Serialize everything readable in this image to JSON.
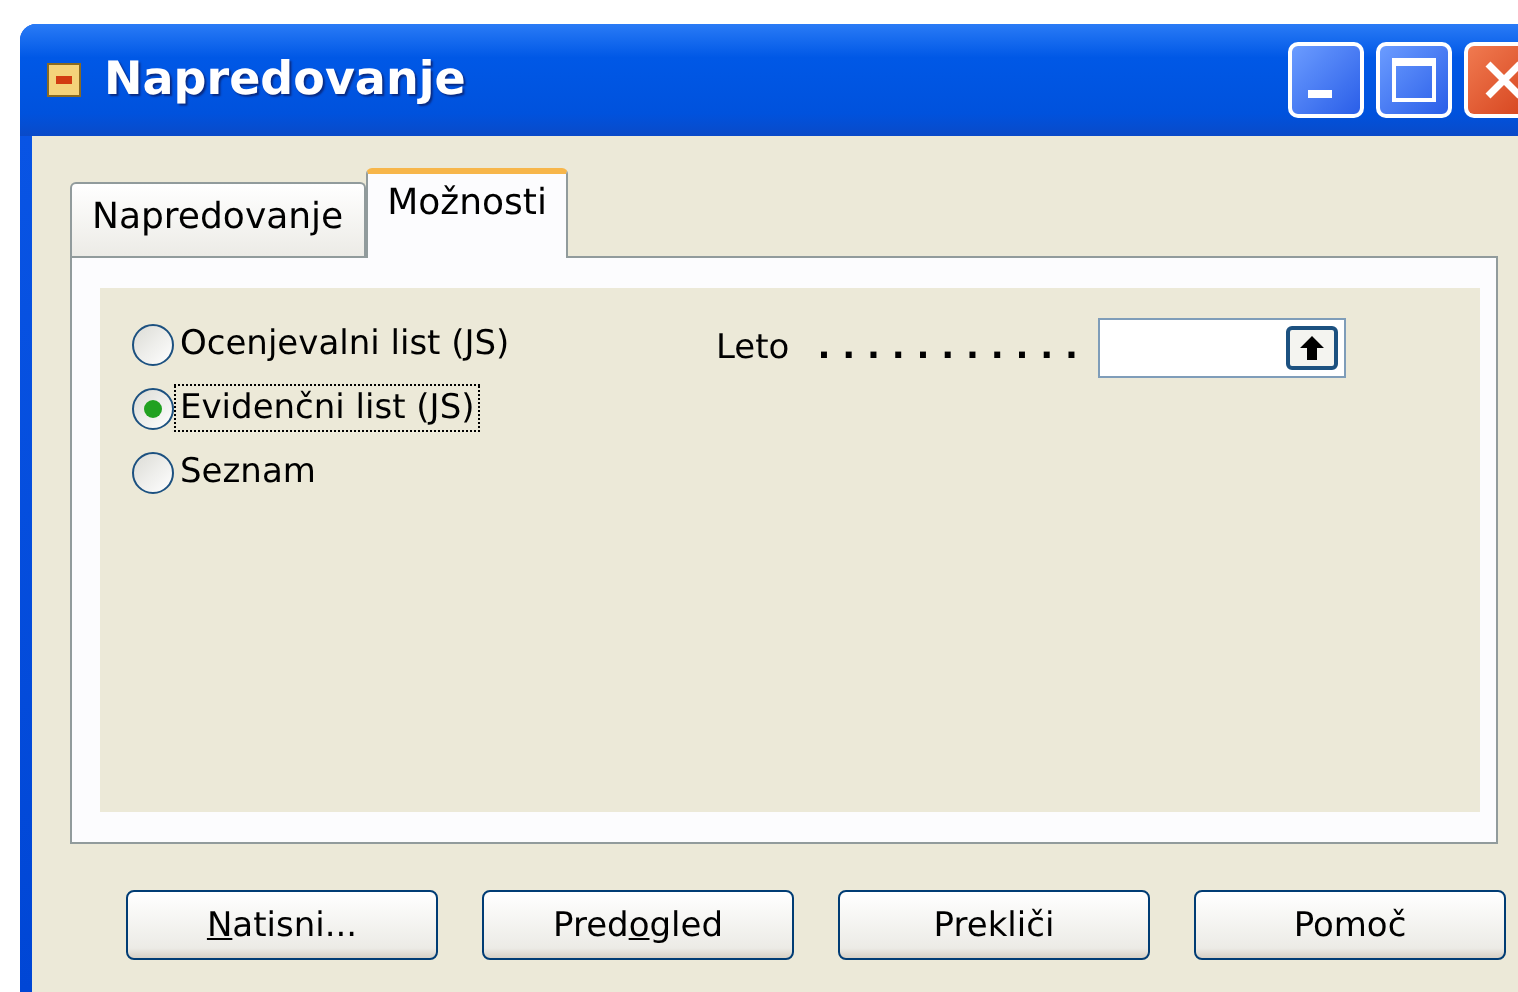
{
  "window": {
    "title": "Napredovanje"
  },
  "tabs": [
    {
      "label": "Napredovanje",
      "selected": false
    },
    {
      "label": "Možnosti",
      "selected": true
    }
  ],
  "options": [
    {
      "label": "Ocenjevalni list (JS)",
      "selected": false,
      "focused": false
    },
    {
      "label": "Evidenčni list (JS)",
      "selected": true,
      "focused": true
    },
    {
      "label": "Seznam",
      "selected": false,
      "focused": false
    }
  ],
  "year_field": {
    "label": "Leto",
    "dots": ". . . . . . . . . . ."
  },
  "buttons": [
    {
      "accelerator": "N",
      "after": "atisni..."
    },
    {
      "before": "Pred",
      "accelerator": "o",
      "after": "gled"
    },
    {
      "after": "Prekliči"
    },
    {
      "after": "Pomoč"
    }
  ]
}
